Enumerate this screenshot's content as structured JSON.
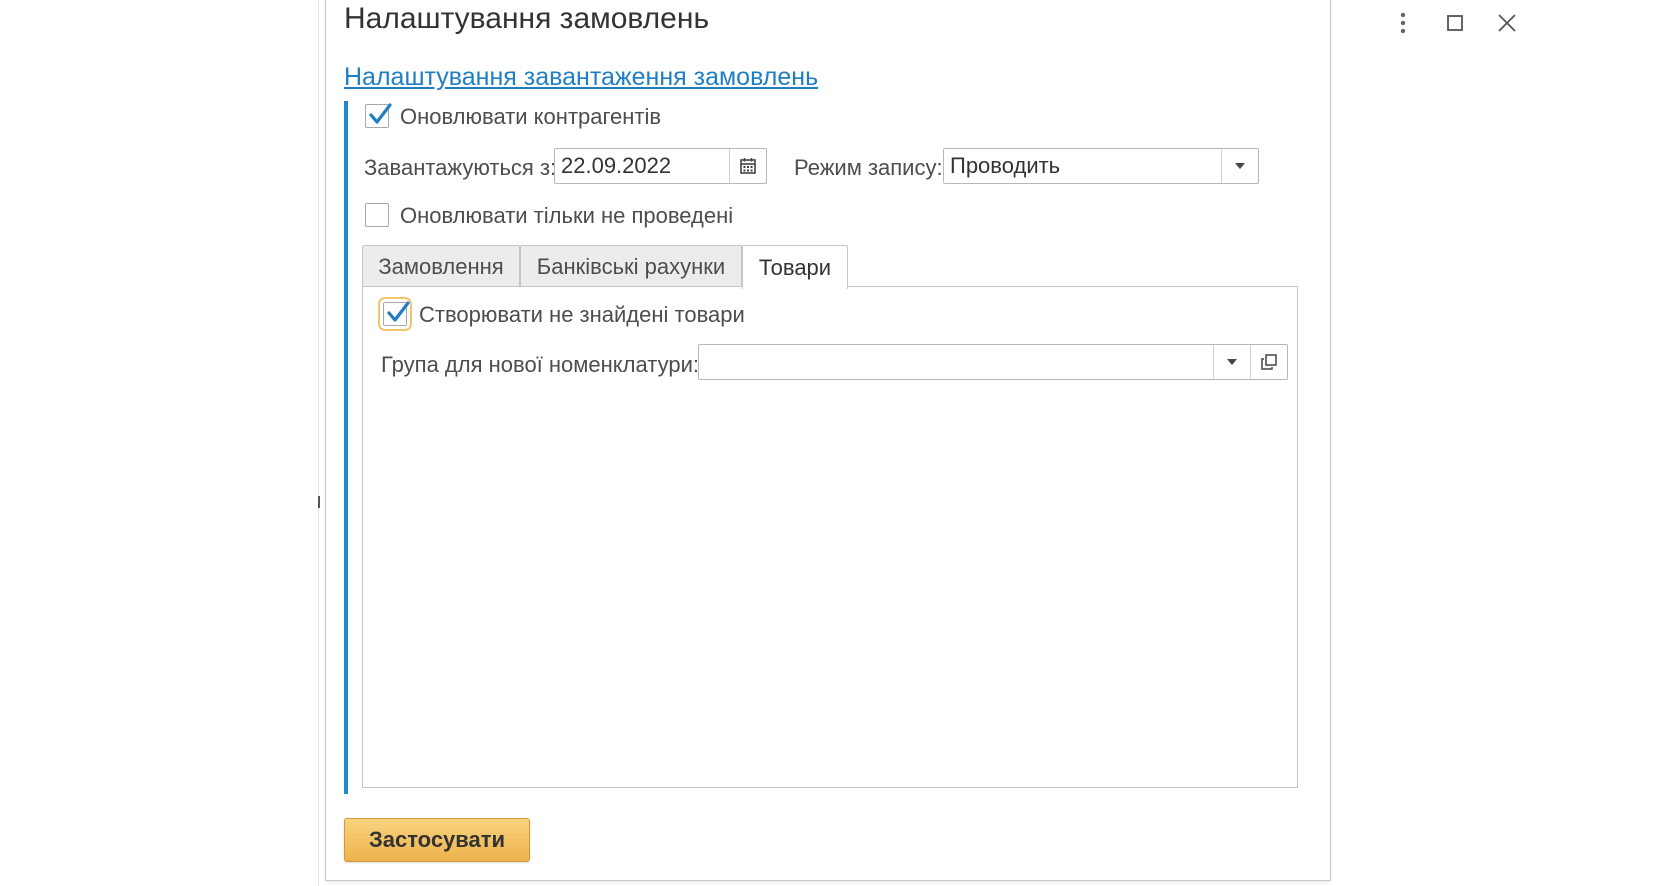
{
  "window": {
    "title": "Налаштування замовлень"
  },
  "section": {
    "link_label": "Налаштування завантаження замовлень"
  },
  "options": {
    "update_counterparties": {
      "label": "Оновлювати контрагентів",
      "checked": true
    },
    "loaded_from": {
      "label": "Завантажуються з:",
      "value": "22.09.2022"
    },
    "write_mode": {
      "label": "Режим запису:",
      "value": "Проводить"
    },
    "update_only_unposted": {
      "label": "Оновлювати тільки не проведені",
      "checked": false
    }
  },
  "tabs": [
    {
      "label": "Замовлення",
      "active": false
    },
    {
      "label": "Банківські рахунки",
      "active": false
    },
    {
      "label": "Товари",
      "active": true
    }
  ],
  "goods_tab": {
    "create_missing": {
      "label": "Створювати не знайдені товари",
      "checked": true
    },
    "group_new_items": {
      "label": "Група для нової номенклатури:",
      "value": ""
    }
  },
  "footer": {
    "apply_label": "Застосувати"
  },
  "colors": {
    "link": "#1f7ec4",
    "group_bar": "#1f8ac9",
    "check": "#1f7ec4",
    "apply_button": "#f2c062",
    "focus_outline": "#f2c46d"
  },
  "icons": {
    "more": "more-vertical-icon",
    "maximize": "maximize-icon",
    "close": "close-icon",
    "calendar": "calendar-icon",
    "dropdown": "chevron-down-icon",
    "open": "open-in-window-icon"
  }
}
